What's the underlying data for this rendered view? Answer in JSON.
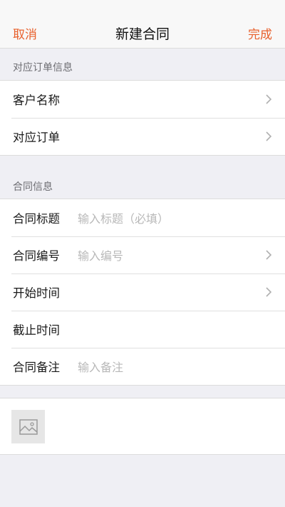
{
  "navbar": {
    "cancel_label": "取消",
    "title": "新建合同",
    "done_label": "完成"
  },
  "order_section": {
    "header": "对应订单信息",
    "rows": [
      {
        "label": "客户名称",
        "icon": "chevron-right-icon"
      },
      {
        "label": "对应订单",
        "icon": "chevron-right-icon"
      }
    ]
  },
  "contract_section": {
    "header": "合同信息",
    "rows": [
      {
        "label": "合同标题",
        "placeholder": "输入标题（必填）"
      },
      {
        "label": "合同编号",
        "placeholder": "输入编号",
        "icon": "chevron-right-icon"
      },
      {
        "label": "开始时间",
        "icon": "chevron-right-icon"
      },
      {
        "label": "截止时间"
      },
      {
        "label": "合同备注",
        "placeholder": "输入备注"
      }
    ]
  },
  "attachment": {
    "icon": "image-placeholder-icon"
  },
  "colors": {
    "accent": "#e8602c",
    "background": "#efeff4",
    "placeholder": "#b8b8b8"
  }
}
